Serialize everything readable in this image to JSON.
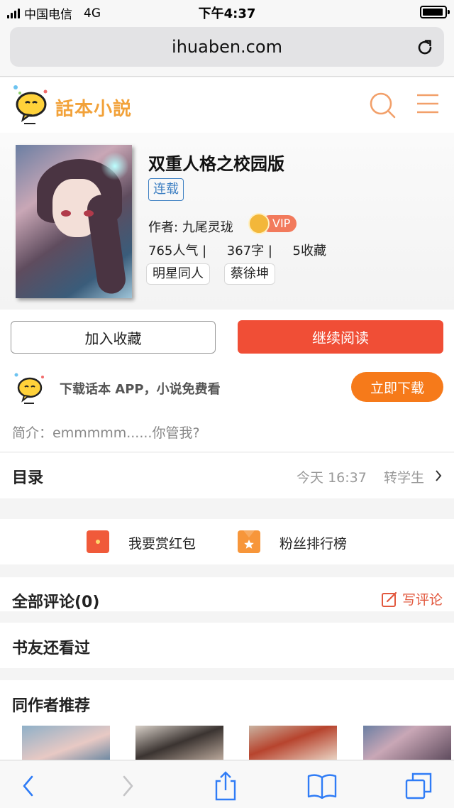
{
  "status_bar": {
    "carrier": "中国电信",
    "network": "4G",
    "time": "下午4:37"
  },
  "browser": {
    "url": "ihuaben.com"
  },
  "site": {
    "logo_text": "話本小説"
  },
  "book": {
    "title": "双重人格之校园版",
    "status_tag": "连载",
    "author_line": "作者: 九尾灵珑",
    "vip_label": "VIP",
    "stats_line": "765人气 |     367字 |     5收藏",
    "tags": [
      "明星同人",
      "蔡徐坤"
    ]
  },
  "actions": {
    "add_favorite": "加入收藏",
    "continue_reading": "继续阅读"
  },
  "promo": {
    "text": "下载话本 APP，小说免费看",
    "download_button": "立即下载"
  },
  "summary": {
    "text": "简介：emmmmm......你管我?"
  },
  "toc": {
    "title": "目录",
    "latest": "今天 16:37    转学生"
  },
  "reward": {
    "red_packet_label": "我要赏红包",
    "fan_rank_label": "粉丝排行榜"
  },
  "comments": {
    "title": "全部评论(0)",
    "write_label": "写评论"
  },
  "also_read": {
    "title": "书友还看过"
  },
  "same_author": {
    "title": "同作者推荐"
  },
  "colors": {
    "accent_red": "#f04e36",
    "accent_orange": "#f67a1a",
    "logo_orange": "#f2a23a",
    "link_blue": "#3d7fc2",
    "ios_blue": "#2f7cf6"
  }
}
